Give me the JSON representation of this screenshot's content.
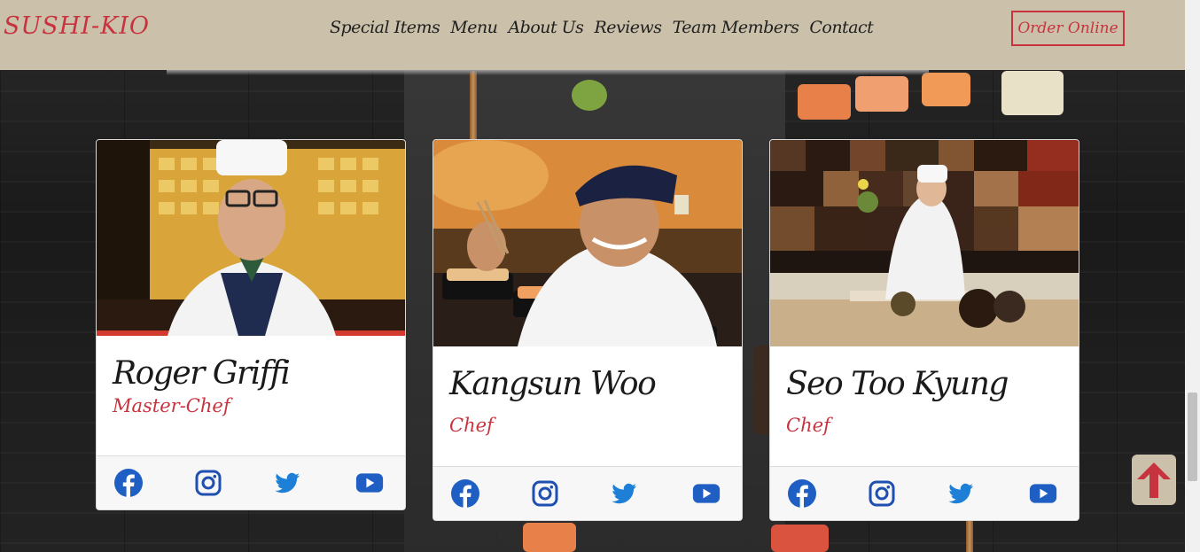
{
  "brand": "SUSHI-KIO",
  "nav": {
    "links": [
      "Special Items",
      "Menu",
      "About Us",
      "Reviews",
      "Team Members",
      "Contact"
    ],
    "order_button": "Order Online"
  },
  "team": [
    {
      "name": "Roger Griffi",
      "role": "Master-Chef",
      "social": [
        "facebook-icon",
        "instagram-icon",
        "twitter-icon",
        "youtube-icon"
      ]
    },
    {
      "name": "Kangsun Woo",
      "role": "Chef",
      "social": [
        "facebook-icon",
        "instagram-icon",
        "twitter-icon",
        "youtube-icon"
      ]
    },
    {
      "name": "Seo Too Kyung",
      "role": "Chef",
      "social": [
        "facebook-icon",
        "instagram-icon",
        "twitter-icon",
        "youtube-icon"
      ]
    }
  ],
  "colors": {
    "accent": "#c7343f",
    "navbar": "#cbc1aa",
    "facebook": "#1877f2",
    "instagram": "#1f4fb0",
    "twitter": "#1d9bf0",
    "youtube": "#1f5fc4"
  },
  "back_to_top_icon": "arrow-up-icon"
}
